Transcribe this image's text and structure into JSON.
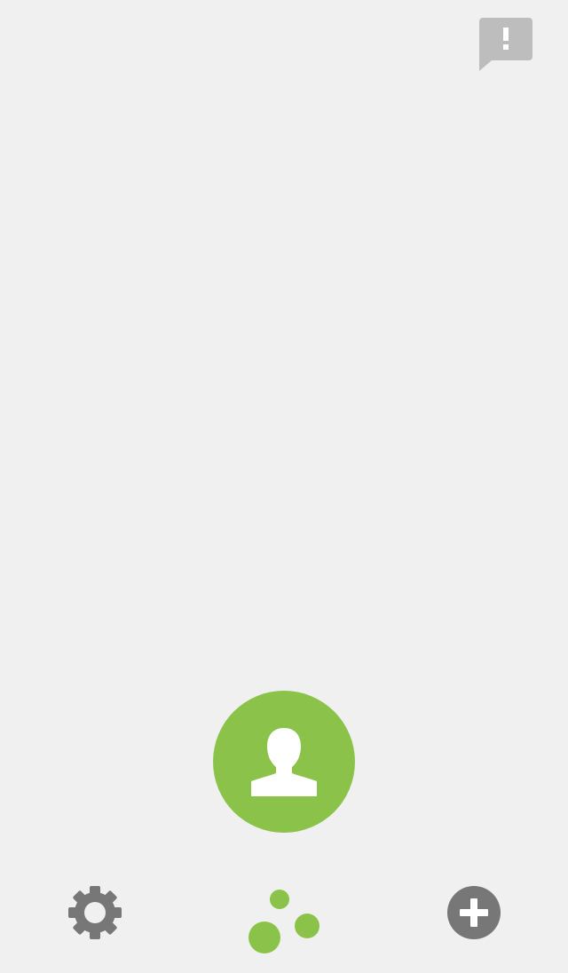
{
  "colors": {
    "background": "#f0f0f0",
    "accent": "#8bc34a",
    "icon_gray": "#777777",
    "feedback_gray": "#bdbdbd",
    "white": "#ffffff"
  },
  "header": {
    "feedback_button": {
      "icon": "feedback-icon"
    }
  },
  "main": {
    "profile_button": {
      "icon": "person-icon"
    }
  },
  "bottom_nav": {
    "settings": {
      "icon": "gear-icon"
    },
    "home": {
      "icon": "dots-icon"
    },
    "add": {
      "icon": "plus-circle-icon"
    }
  }
}
